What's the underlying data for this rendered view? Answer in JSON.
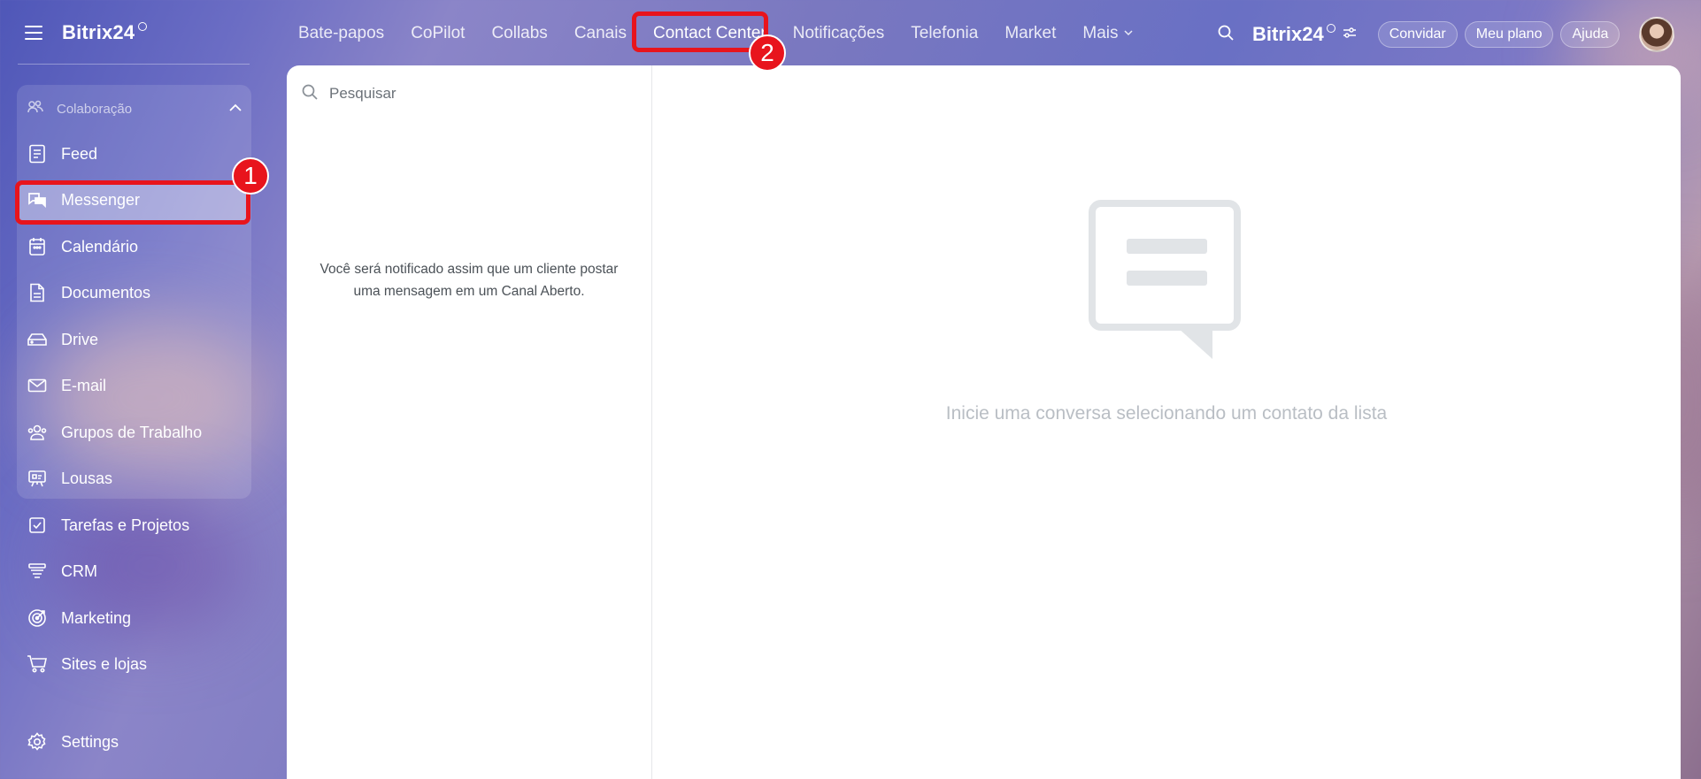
{
  "app": {
    "logo": "Bitrix24",
    "brand": "Bitrix24"
  },
  "sidebar": {
    "group_label": "Colaboração",
    "items": [
      {
        "label": "Feed",
        "icon": "feed-icon"
      },
      {
        "label": "Messenger",
        "icon": "chat-icon",
        "active": true
      },
      {
        "label": "Calendário",
        "icon": "calendar-icon"
      },
      {
        "label": "Documentos",
        "icon": "document-icon"
      },
      {
        "label": "Drive",
        "icon": "drive-icon"
      },
      {
        "label": "E-mail",
        "icon": "mail-icon"
      },
      {
        "label": "Grupos de Trabalho",
        "icon": "group-icon"
      },
      {
        "label": "Lousas",
        "icon": "board-icon"
      },
      {
        "label": "Tarefas e Projetos",
        "icon": "task-icon"
      },
      {
        "label": "CRM",
        "icon": "crm-icon"
      },
      {
        "label": "Marketing",
        "icon": "marketing-icon"
      },
      {
        "label": "Sites e lojas",
        "icon": "cart-icon"
      }
    ],
    "settings_label": "Settings"
  },
  "topnav": {
    "tabs": [
      {
        "label": "Bate-papos"
      },
      {
        "label": "CoPilot"
      },
      {
        "label": "Collabs"
      },
      {
        "label": "Canais"
      },
      {
        "label": "Contact Center",
        "active": true
      },
      {
        "label": "Notificações"
      },
      {
        "label": "Telefonia"
      },
      {
        "label": "Market"
      },
      {
        "label": "Mais"
      }
    ],
    "invite_label": "Convidar",
    "plan_label": "Meu plano",
    "help_label": "Ajuda"
  },
  "left_panel": {
    "search_placeholder": "Pesquisar",
    "notice": "Você será notificado assim que um cliente postar uma mensagem em um Canal Aberto."
  },
  "right_panel": {
    "empty_text": "Inicie uma conversa selecionando um contato da lista"
  },
  "annotations": [
    {
      "number": "1",
      "target": "Messenger"
    },
    {
      "number": "2",
      "target": "Contact Center"
    }
  ],
  "colors": {
    "highlight": "#e8141c",
    "panel": "#ffffff"
  }
}
